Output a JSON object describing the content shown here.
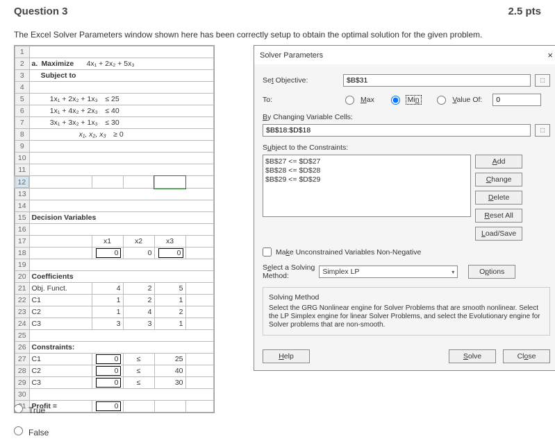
{
  "header": {
    "q": "Question 3",
    "pts": "2.5 pts"
  },
  "prompt": "The Excel Solver Parameters window shown here has been correctly setup to obtain the optimal solution for the given problem.",
  "problem": {
    "title_a": "a.",
    "title_b": "Maximize",
    "obj": "4x₁ + 2x₂ + 5x₃",
    "subj": "Subject to",
    "c1": "1x₁ + 2x₂ + 1x₃",
    "c1r": "≤ 25",
    "c2": "1x₁ + 4x₂ + 2x₃",
    "c2r": "≤ 40",
    "c3": "3x₁ + 3x₂ + 1x₃",
    "c3r": "≤ 30",
    "c4": "x₁, x₂, x₃",
    "c4r": "≥ 0"
  },
  "sheet": {
    "decvar": "Decision Variables",
    "h": {
      "x1": "x1",
      "x2": "x2",
      "x3": "x3"
    },
    "v": {
      "x1": "0",
      "x2": "0",
      "x3": "0"
    },
    "coeff": "Coefficients",
    "rows": [
      {
        "n": "Obj. Funct.",
        "a": "4",
        "b": "2",
        "c": "5"
      },
      {
        "n": "C1",
        "a": "1",
        "b": "2",
        "c": "1"
      },
      {
        "n": "C2",
        "a": "1",
        "b": "4",
        "c": "2"
      },
      {
        "n": "C3",
        "a": "3",
        "b": "3",
        "c": "1"
      }
    ],
    "cons": "Constraints:",
    "crows": [
      {
        "n": "C1",
        "v": "0",
        "op": "≤",
        "r": "25"
      },
      {
        "n": "C2",
        "v": "0",
        "op": "≤",
        "r": "40"
      },
      {
        "n": "C3",
        "v": "0",
        "op": "≤",
        "r": "30"
      }
    ],
    "profit": "Profit =",
    "profitv": "0"
  },
  "dlg": {
    "title": "Solver Parameters",
    "setobj": "Set Objective:",
    "setobjv": "$B$31",
    "to": "To:",
    "max": "Max",
    "min": "Min",
    "valof": "Value Of:",
    "valofv": "0",
    "bychg": "By Changing Variable Cells:",
    "bychgv": "$B$18:$D$18",
    "subjcon": "Subject to the Constraints:",
    "cons": [
      "$B$27 <= $D$27",
      "$B$28 <= $D$28",
      "$B$29 <= $D$29"
    ],
    "btns": {
      "add": "Add",
      "change": "Change",
      "delete": "Delete",
      "reset": "Reset All",
      "load": "Load/Save",
      "options": "Options"
    },
    "nonneg": "Make Unconstrained Variables Non-Negative",
    "selmeth": "Select a Solving Method:",
    "method": "Simplex LP",
    "smlbl": "Solving Method",
    "smtext": "Select the GRG Nonlinear engine for Solver Problems that are smooth nonlinear. Select the LP Simplex engine for linear Solver Problems, and select the Evolutionary engine for Solver problems that are non-smooth.",
    "help": "Help",
    "solve": "Solve",
    "close": "Close"
  },
  "answers": {
    "t": "True",
    "f": "False"
  }
}
